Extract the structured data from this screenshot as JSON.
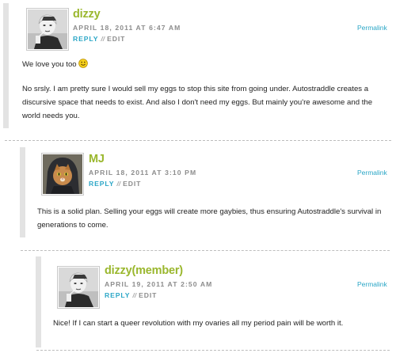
{
  "comments": [
    {
      "author": "dizzy",
      "date": "APRIL 18, 2011 AT 6:47 AM",
      "reply": "REPLY",
      "separator": "//",
      "edit": "EDIT",
      "permalink": "Permalink",
      "paragraph1": "We love you too",
      "paragraph1_icon": "smiley-icon",
      "paragraph2": "No srsly. I am pretty sure I would sell my eggs to stop this site from going under. Autostraddle creates a discursive space that needs to exist. And also I don't need my eggs. But mainly you're awesome and the world needs you."
    },
    {
      "author": "MJ",
      "date": "APRIL 18, 2011 AT 3:10 PM",
      "reply": "REPLY",
      "separator": "//",
      "edit": "EDIT",
      "permalink": "Permalink",
      "paragraph1": "This is a solid plan. Selling your eggs will create more gaybies, thus ensuring Autostraddle's survival in generations to come."
    },
    {
      "author": "dizzy(member)",
      "date": "APRIL 19, 2011 AT 2:50 AM",
      "reply": "REPLY",
      "separator": "//",
      "edit": "EDIT",
      "permalink": "Permalink",
      "paragraph1": "Nice! If I can start a queer revolution with my ovaries all my period pain will be worth it."
    }
  ],
  "colors": {
    "author": "#9ab72d",
    "link": "#2aa6c6",
    "meta": "#8c8c8c",
    "bar": "#e3e3e3"
  }
}
